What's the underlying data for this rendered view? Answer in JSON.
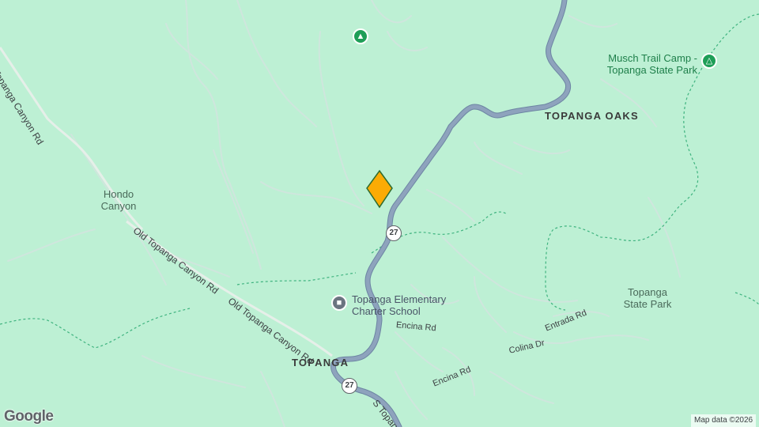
{
  "map": {
    "colors": {
      "land": "#bdf0d4",
      "highway": "#8ea3bd",
      "highway_outline": "#6d85a3",
      "minor_road": "#cfe6dd",
      "trail": "#3fb37f",
      "marker_fill": "#fbab05",
      "marker_stroke": "#2e6b2e",
      "park_pin": "#1e9e57",
      "school_pin": "#6b7480"
    },
    "places": {
      "topanga_oaks": "TOPANGA OAKS",
      "topanga": "TOPANGA",
      "hondo_canyon": "Hondo Canyon",
      "topanga_state_park": "Topanga State Park"
    },
    "pois": {
      "musch_camp": {
        "label": "Musch Trail Camp - Topanga State Park",
        "icon": "campground-icon"
      },
      "school": {
        "label": "Topanga Elementary Charter School",
        "icon": "school-icon"
      },
      "tree": {
        "icon": "tree-icon"
      }
    },
    "roads": {
      "topanga_canyon_rd_nw": "Topanga Canyon Rd",
      "old_topanga_1": "Old Topanga Canyon Rd",
      "old_topanga_2": "Old Topanga Canyon Rd",
      "encina_1": "Encina Rd",
      "encina_2": "Encina Rd",
      "entrada": "Entrada Rd",
      "colina": "Colina Dr",
      "s_topanga": "S Topanga"
    },
    "route_shields": [
      "27",
      "27"
    ],
    "selected_marker": {
      "icon": "location-marker-icon"
    },
    "google_logo": "Google",
    "attribution": "Map data ©2026"
  }
}
